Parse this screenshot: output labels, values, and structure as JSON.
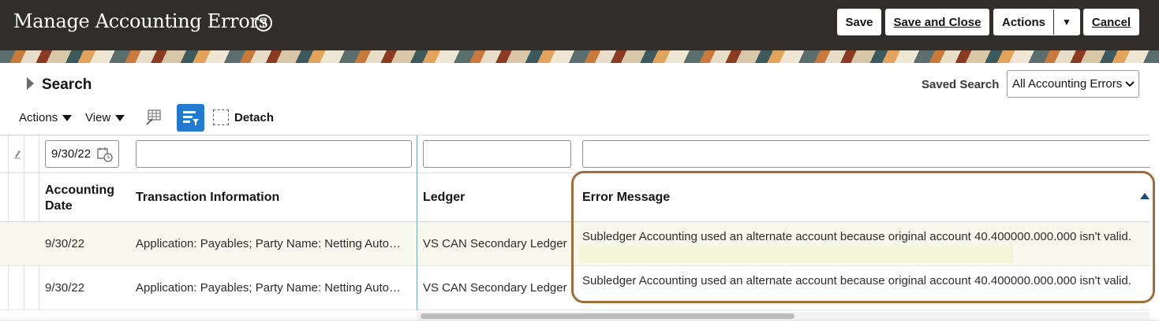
{
  "header": {
    "title": "Manage Accounting Errors",
    "help_icon": "?",
    "save_label": "Save",
    "save_close_label": "Save and Close",
    "actions_label": "Actions",
    "cancel_label": "Cancel"
  },
  "search": {
    "title": "Search",
    "saved_search_label": "Saved Search",
    "saved_search_value": "All Accounting Errors"
  },
  "toolbar": {
    "actions_label": "Actions",
    "view_label": "View",
    "detach_label": "Detach"
  },
  "filters": {
    "accounting_date": "9/30/22",
    "transaction_information": "",
    "ledger": "",
    "error_message": ""
  },
  "table": {
    "columns": [
      "Accounting Date",
      "Transaction Information",
      "Ledger",
      "Error Message"
    ],
    "column_date_line1": "Accounting",
    "column_date_line2": "Date",
    "rows": [
      {
        "date": "9/30/22",
        "transaction": "Application: Payables; Party Name: Netting Auto…",
        "ledger": "VS CAN Secondary Ledger",
        "error": "Subledger Accounting used an alternate account because original account 40.400000.000.000 isn't valid."
      },
      {
        "date": "9/30/22",
        "transaction": "Application: Payables; Party Name: Netting Auto…",
        "ledger": "VS CAN Secondary Ledger",
        "error": "Subledger Accounting used an alternate account because original account 40.400000.000.000 isn't valid."
      }
    ]
  },
  "colors": {
    "header_bg": "#312d2a",
    "accent": "#227bd1",
    "highlight": "#a16d3c"
  }
}
